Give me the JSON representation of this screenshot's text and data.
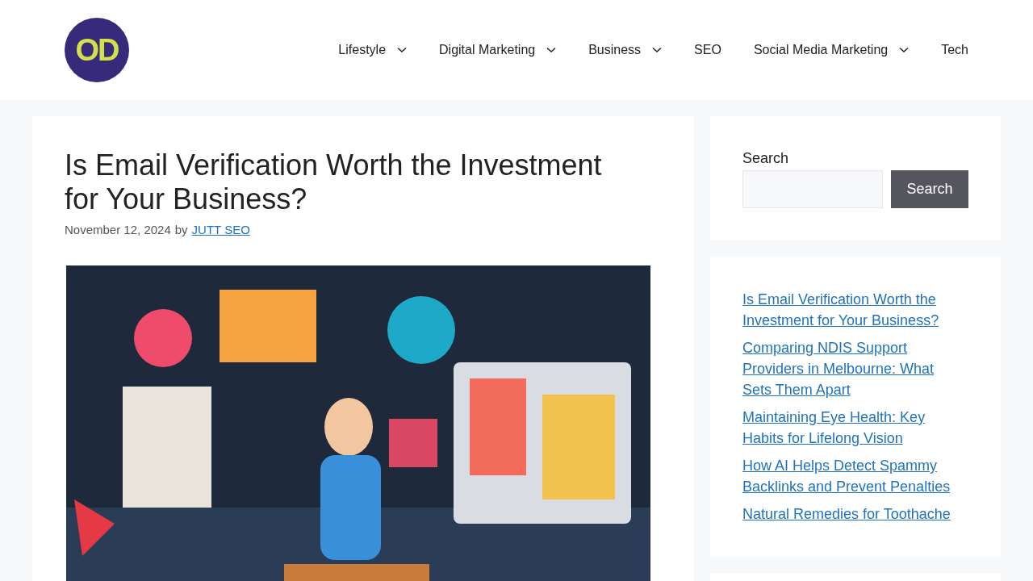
{
  "logo": {
    "text": "OD"
  },
  "nav": [
    {
      "label": "Lifestyle",
      "dropdown": true
    },
    {
      "label": "Digital Marketing",
      "dropdown": true
    },
    {
      "label": "Business",
      "dropdown": true
    },
    {
      "label": "SEO",
      "dropdown": false
    },
    {
      "label": "Social Media Marketing",
      "dropdown": true
    },
    {
      "label": "Tech",
      "dropdown": false
    }
  ],
  "article": {
    "title": "Is Email Verification Worth the Investment for Your Business?",
    "date": "November 12, 2024",
    "by": "by",
    "author": "JUTT SEO"
  },
  "search": {
    "label": "Search",
    "button": "Search"
  },
  "recent_posts": [
    "Is Email Verification Worth the Investment for Your Business?",
    "Comparing NDIS Support Providers in Melbourne: What Sets Them Apart",
    "Maintaining Eye Health: Key Habits for Lifelong Vision",
    "How AI Helps Detect Spammy Backlinks and Prevent Penalties",
    "Natural Remedies for Toothache"
  ]
}
